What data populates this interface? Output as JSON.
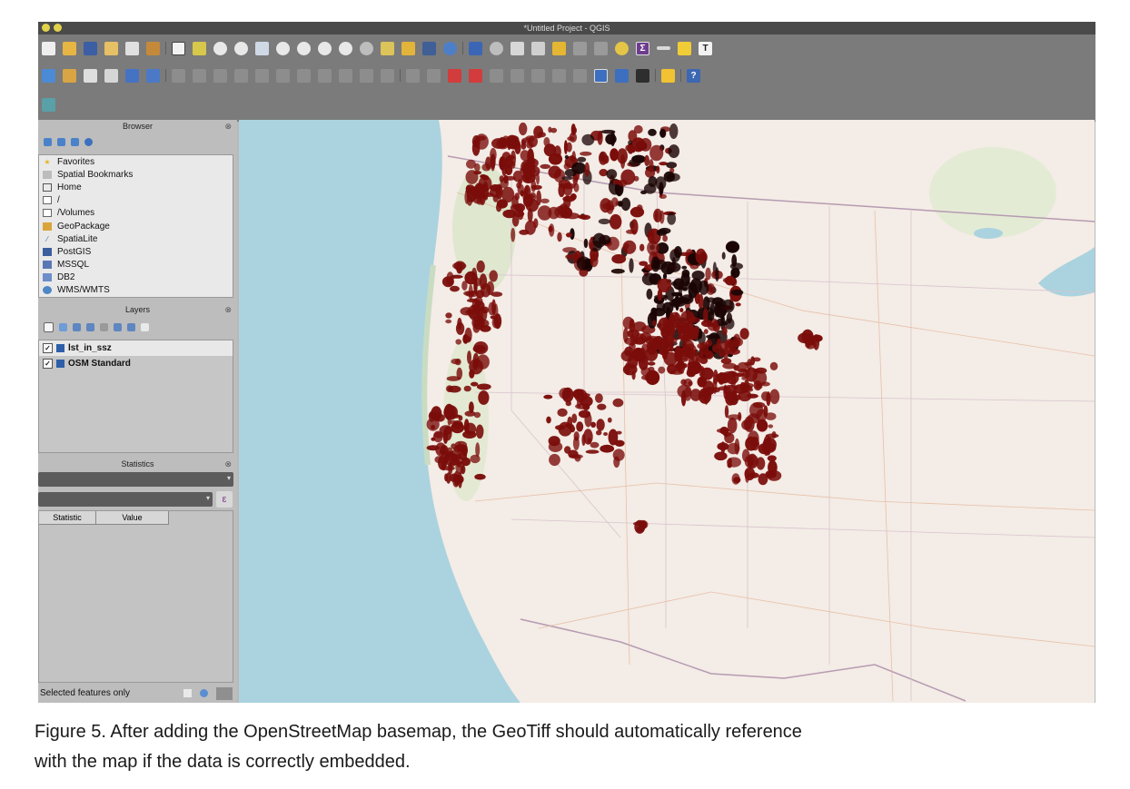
{
  "window": {
    "title": "*Untitled Project - QGIS"
  },
  "toolbar": {
    "row1_icons": [
      "new-file",
      "open-folder",
      "save",
      "save-as",
      "print-layout",
      "layout-manager",
      "pan",
      "pan-to-selection",
      "zoom-in",
      "zoom-out",
      "zoom-full",
      "zoom-selection",
      "zoom-layer",
      "zoom-native",
      "zoom-last",
      "zoom-next",
      "new-map-view",
      "refresh",
      "identify",
      "select-features",
      "deselect",
      "attribute-table",
      "field-calculator",
      "toolbox",
      "statistics-sum",
      "measure",
      "map-tips",
      "text-annotation"
    ],
    "row2_icons": [
      "add-vector-layer",
      "add-raster-layer",
      "add-delimited-text",
      "digitize",
      "add-point",
      "current-edits",
      "toggle-editing",
      "save-edits",
      "add-feature",
      "move-feature",
      "node-tool",
      "delete-selected",
      "cut-features",
      "copy-features",
      "paste-features",
      "undo",
      "redo",
      "label-tool",
      "pin-labels",
      "show-hide-labels",
      "move-label",
      "rotate-label",
      "change-label",
      "diagram",
      "georeferencer",
      "python-console",
      "help"
    ],
    "sum_glyph": "Σ",
    "text_glyph": "T",
    "help_glyph": "?"
  },
  "browser": {
    "title": "Browser",
    "close_glyph": "⊗",
    "items": [
      {
        "label": "Favorites",
        "icon": "star-icon"
      },
      {
        "label": "Spatial Bookmarks",
        "icon": "bookmark-icon"
      },
      {
        "label": "Home",
        "icon": "home-icon"
      },
      {
        "label": "/",
        "icon": "folder-icon"
      },
      {
        "label": "/Volumes",
        "icon": "folder-icon"
      },
      {
        "label": "GeoPackage",
        "icon": "geopackage-icon"
      },
      {
        "label": "SpatiaLite",
        "icon": "spatialite-icon"
      },
      {
        "label": "PostGIS",
        "icon": "postgis-icon"
      },
      {
        "label": "MSSQL",
        "icon": "mssql-icon"
      },
      {
        "label": "DB2",
        "icon": "db2-icon"
      },
      {
        "label": "WMS/WMTS",
        "icon": "wms-icon"
      }
    ]
  },
  "layers": {
    "title": "Layers",
    "close_glyph": "⊗",
    "items": [
      {
        "label": "lst_in_ssz",
        "checked": true,
        "selected": true
      },
      {
        "label": "OSM Standard",
        "checked": true,
        "selected": false
      }
    ]
  },
  "statistics": {
    "title": "Statistics",
    "close_glyph": "⊗",
    "columns": [
      "Statistic",
      "Value"
    ],
    "expression_glyph": "ε",
    "selected_only_label": "Selected features only"
  },
  "caption": {
    "line1": "Figure 5. After adding the OpenStreetMap basemap, the GeoTiff should automatically reference",
    "line2": "with the map if the data is correctly embedded."
  },
  "colors": {
    "raster": "#7a0d0a",
    "raster_dark": "#1a0404",
    "ocean": "#aad3df",
    "land": "#f4ece6",
    "toolbar_bg": "#7b7b7b",
    "panel_bg": "#bdbdbd"
  }
}
